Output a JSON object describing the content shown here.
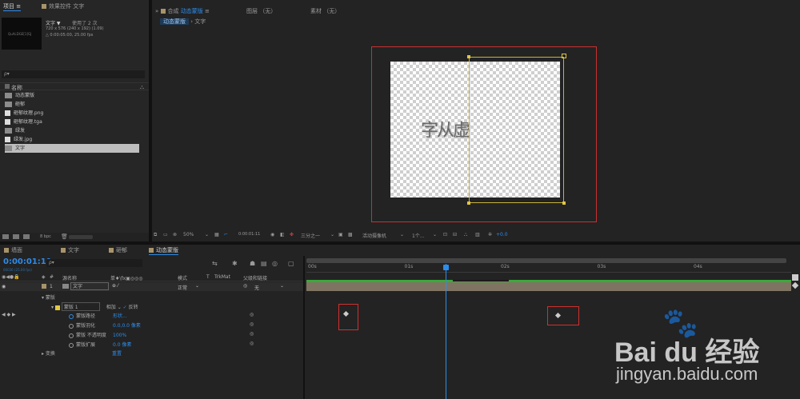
{
  "project_panel": {
    "tab_project": "项目",
    "tab_effects": "效果控件 文字",
    "item_name": "文字 ▼",
    "item_usage": "使用了 2 次",
    "item_dims": "720 x 576  (240 x 192) (1.09)",
    "item_duration": "△ 0:00:05:00, 25.00 fps",
    "thumb_text": "QuALDGE[1]GJ",
    "search_placeholder": "ρ▾",
    "col_name": "名称",
    "items": [
      {
        "label": "动态蒙版",
        "kind": "comp"
      },
      {
        "label": "砸郁",
        "kind": "comp"
      },
      {
        "label": "砸郁纹理.png",
        "kind": "file"
      },
      {
        "label": "砸郁纹理.tga",
        "kind": "file"
      },
      {
        "label": "绿发",
        "kind": "comp"
      },
      {
        "label": "绿发.jpg",
        "kind": "file"
      },
      {
        "label": "文字",
        "kind": "comp",
        "selected": true
      }
    ],
    "bpc": "8 bpc"
  },
  "viewer": {
    "tab_comp_prefix": "合成",
    "tab_comp_name": "动态蒙版",
    "tab_layer": "图层 （无）",
    "tab_footage": "素材 （无）",
    "breadcrumb": [
      "动态蒙版",
      "文字"
    ],
    "canvas_text": "字从虚",
    "zoom": "50%",
    "timecode": "0:00:01:11",
    "resolution": "三分之一",
    "camera": "活动摄像机",
    "views": "1个...",
    "exposure": "+0.0"
  },
  "timeline": {
    "tabs": [
      "墙面",
      "文字",
      "砸郁",
      "动态蒙版"
    ],
    "current_time": "0:00:01:11",
    "frame_info": "00036 (25.00 fps)",
    "search_placeholder": "ρ▾",
    "headers": {
      "num": "#",
      "name": "源名称",
      "switches": "单♦\\fx▣◎◎◎",
      "mode": "模式",
      "t": "T",
      "trkmat": "TrkMat",
      "parent": "父级和链接"
    },
    "layer": {
      "index": "1",
      "name": "文字",
      "mode": "正常",
      "parent": "无"
    },
    "group_masks": "蒙版",
    "mask": {
      "name": "蒙版 1",
      "mode": "相加",
      "inverted": "反转"
    },
    "props": [
      {
        "label": "蒙版路径",
        "value": "形状..."
      },
      {
        "label": "蒙版羽化",
        "value": "0.0,0.0 像素"
      },
      {
        "label": "蒙版 不透明度",
        "value": "100%"
      },
      {
        "label": "蒙版扩展",
        "value": "0.0 像素"
      }
    ],
    "group_transform": "变换",
    "transform_value": "重置",
    "ruler": [
      "00s",
      "01s",
      "02s",
      "03s",
      "04s"
    ]
  },
  "watermark": {
    "brand": "Bai du 经验",
    "url": "jingyan.baidu.com"
  }
}
